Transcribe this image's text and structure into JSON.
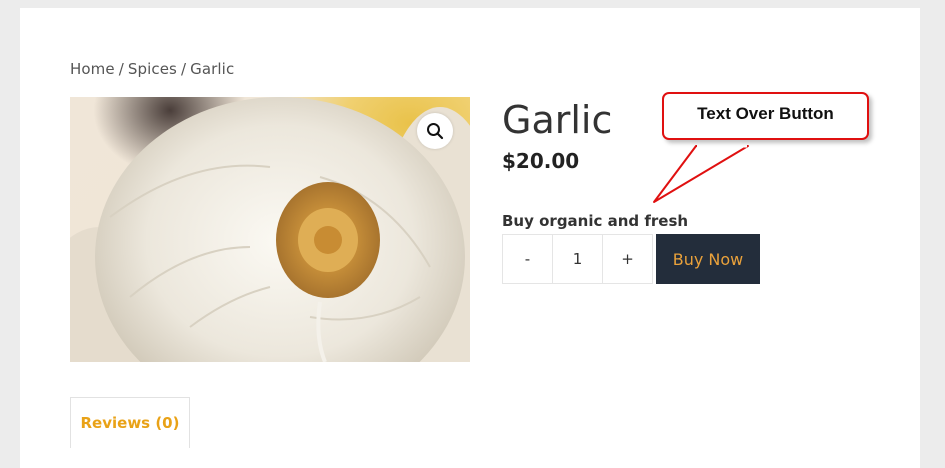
{
  "breadcrumb": {
    "items": [
      "Home",
      "Spices",
      "Garlic"
    ],
    "separator": "/"
  },
  "product": {
    "title": "Garlic",
    "price": "$20.00",
    "promo_text": "Buy organic and fresh",
    "image_icon": "garlic-photo"
  },
  "quantity": {
    "minus_label": "-",
    "value": "1",
    "plus_label": "+"
  },
  "buy_button": {
    "label": "Buy Now"
  },
  "callout": {
    "text": "Text Over Button"
  },
  "tabs": [
    {
      "label": "Reviews (0)"
    }
  ],
  "colors": {
    "accent": "#e9a217",
    "buy_bg": "#232d3b",
    "callout_border": "#e01010"
  }
}
